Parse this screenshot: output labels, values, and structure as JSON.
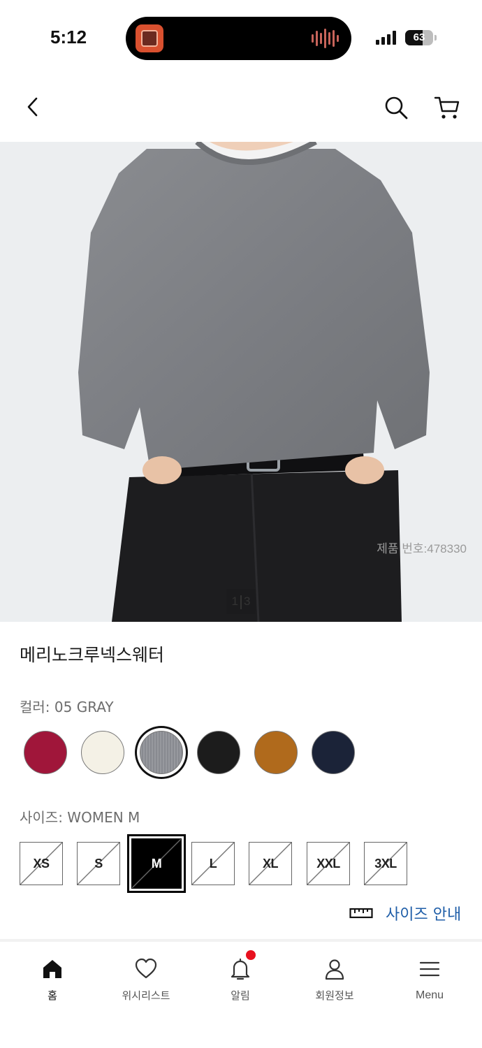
{
  "status_bar": {
    "time": "5:12",
    "battery_level": "63"
  },
  "header": {
    "back_icon": "chevron-left-icon",
    "search_icon": "search-icon",
    "cart_icon": "cart-icon"
  },
  "gallery": {
    "product_code": "제품 번호:478330",
    "current_image": "1",
    "total_images": "3"
  },
  "product": {
    "name": "메리노크루넥스웨터",
    "color_label": "컬러: 05 GRAY",
    "colors": [
      {
        "name": "red",
        "hex": "#a0163a",
        "selected": false
      },
      {
        "name": "off-white",
        "hex": "#f4f1e6",
        "selected": false
      },
      {
        "name": "gray",
        "hex": "#8e9096",
        "selected": true
      },
      {
        "name": "black",
        "hex": "#1c1c1c",
        "selected": false
      },
      {
        "name": "brown",
        "hex": "#b06a1c",
        "selected": false
      },
      {
        "name": "navy",
        "hex": "#1b2338",
        "selected": false
      }
    ],
    "size_label": "사이즈: WOMEN M",
    "sizes": [
      {
        "label": "XS",
        "selected": false,
        "unavailable": true
      },
      {
        "label": "S",
        "selected": false,
        "unavailable": true
      },
      {
        "label": "M",
        "selected": true,
        "unavailable": true
      },
      {
        "label": "L",
        "selected": false,
        "unavailable": true
      },
      {
        "label": "XL",
        "selected": false,
        "unavailable": true
      },
      {
        "label": "XXL",
        "selected": false,
        "unavailable": true
      },
      {
        "label": "3XL",
        "selected": false,
        "unavailable": true
      }
    ],
    "size_guide": "사이즈 안내"
  },
  "bottom_nav": {
    "items": [
      {
        "label": "홈",
        "icon": "home-icon",
        "active": true
      },
      {
        "label": "위시리스트",
        "icon": "heart-icon",
        "active": false
      },
      {
        "label": "알림",
        "icon": "bell-icon",
        "active": false,
        "badge": true
      },
      {
        "label": "회원정보",
        "icon": "user-icon",
        "active": false
      },
      {
        "label": "Menu",
        "icon": "menu-icon",
        "active": false
      }
    ]
  },
  "colors": {
    "accent_link": "#1f5ea8",
    "badge": "#e8101e"
  }
}
